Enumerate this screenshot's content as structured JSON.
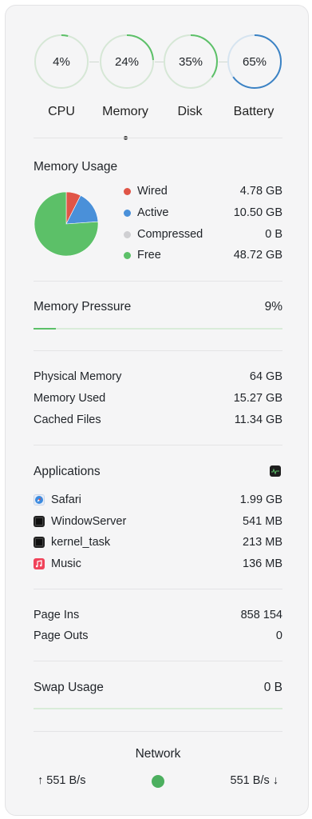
{
  "gauges": [
    {
      "label": "CPU",
      "value": "4%",
      "fraction": 0.04,
      "color": "#5cc068"
    },
    {
      "label": "Memory",
      "value": "24%",
      "fraction": 0.24,
      "color": "#5cc068"
    },
    {
      "label": "Disk",
      "value": "35%",
      "fraction": 0.35,
      "color": "#5cc068"
    },
    {
      "label": "Battery",
      "value": "65%",
      "fraction": 0.65,
      "color": "#3b82c4"
    }
  ],
  "memory_usage": {
    "title": "Memory Usage",
    "legend": [
      {
        "name": "Wired",
        "value": "4.78 GB",
        "color": "#e05547"
      },
      {
        "name": "Active",
        "value": "10.50 GB",
        "color": "#4a90d9"
      },
      {
        "name": "Compressed",
        "value": "0 B",
        "color": "#cfcfd2"
      },
      {
        "name": "Free",
        "value": "48.72 GB",
        "color": "#5cc068"
      }
    ],
    "pie": [
      4.78,
      10.5,
      0,
      48.72
    ]
  },
  "memory_pressure": {
    "title": "Memory Pressure",
    "value": "9%",
    "fraction": 0.09
  },
  "stats": [
    {
      "label": "Physical Memory",
      "value": "64 GB"
    },
    {
      "label": "Memory Used",
      "value": "15.27 GB"
    },
    {
      "label": "Cached Files",
      "value": "11.34 GB"
    }
  ],
  "applications": {
    "title": "Applications",
    "items": [
      {
        "name": "Safari",
        "value": "1.99 GB",
        "icon": "safari-icon"
      },
      {
        "name": "WindowServer",
        "value": "541 MB",
        "icon": "terminal-icon"
      },
      {
        "name": "kernel_task",
        "value": "213 MB",
        "icon": "terminal-icon"
      },
      {
        "name": "Music",
        "value": "136 MB",
        "icon": "music-icon"
      }
    ]
  },
  "pages": [
    {
      "label": "Page Ins",
      "value": "858 154"
    },
    {
      "label": "Page Outs",
      "value": "0"
    }
  ],
  "swap": {
    "title": "Swap Usage",
    "value": "0 B"
  },
  "network": {
    "title": "Network",
    "up": "↑ 551 B/s",
    "down": "551 B/s ↓"
  }
}
